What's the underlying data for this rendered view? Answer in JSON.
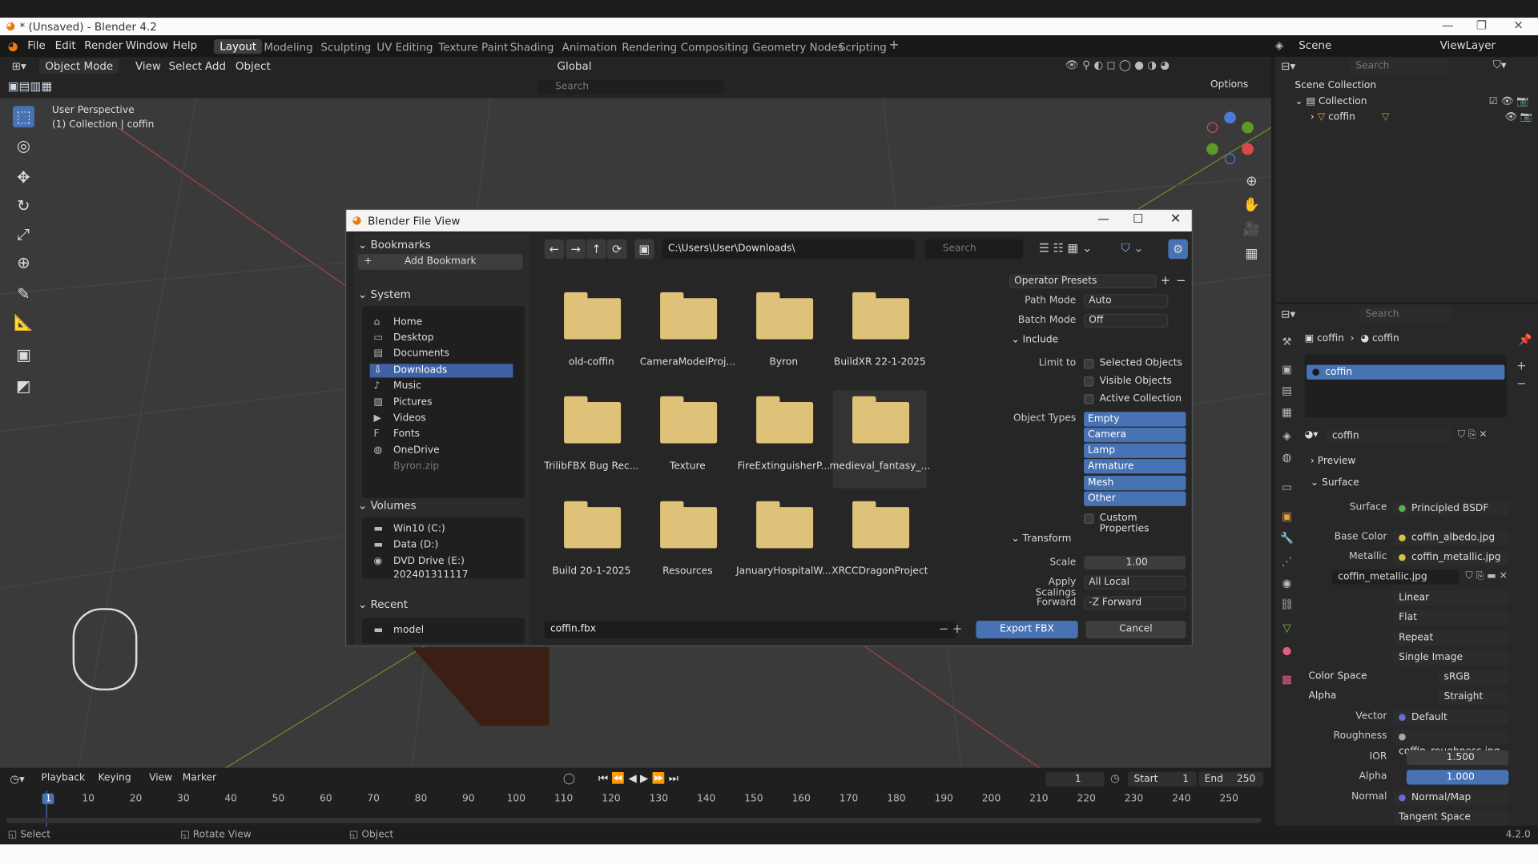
{
  "window": {
    "title": "* (Unsaved) - Blender 4.2"
  },
  "menu": [
    "File",
    "Edit",
    "Render",
    "Window",
    "Help"
  ],
  "workspaces": [
    "Layout",
    "Modeling",
    "Sculpting",
    "UV Editing",
    "Texture Paint",
    "Shading",
    "Animation",
    "Rendering",
    "Compositing",
    "Geometry Nodes",
    "Scripting"
  ],
  "scene": {
    "scene_label": "Scene",
    "viewlayer_label": "ViewLayer"
  },
  "viewport_header": {
    "mode": "Object Mode",
    "view": "View",
    "select": "Select",
    "add": "Add",
    "object": "Object",
    "orientation": "Global",
    "search_placeholder": "Search",
    "options": "Options"
  },
  "viewport": {
    "perspective": "User Perspective",
    "collection_info": "(1) Collection | coffin"
  },
  "dialog": {
    "title": "Blender File View",
    "bookmarks": {
      "header": "Bookmarks",
      "add_label": "Add Bookmark"
    },
    "system": {
      "header": "System",
      "items": [
        "Home",
        "Desktop",
        "Documents",
        "Downloads",
        "Music",
        "Pictures",
        "Videos",
        "Fonts",
        "OneDrive",
        "Byron.zip"
      ]
    },
    "volumes": {
      "header": "Volumes",
      "items": [
        "Win10 (C:)",
        "Data (D:)",
        "DVD Drive (E:) 202401311117"
      ]
    },
    "recent": {
      "header": "Recent",
      "items": [
        "model"
      ]
    },
    "path": "C:\\Users\\User\\Downloads\\",
    "search_placeholder": "Search",
    "folders": [
      "old-coffin",
      "CameraModelProj...",
      "Byron",
      "BuildXR 22-1-2025",
      "TrilibFBX Bug Rec...",
      "Texture",
      "FireExtinguisherP...",
      "medieval_fantasy_...",
      "Build 20-1-2025",
      "Resources",
      "JanuaryHospitalW...",
      "XRCCDragonProject"
    ],
    "filename": "coffin.fbx",
    "export_label": "Export FBX",
    "cancel_label": "Cancel",
    "operator": {
      "presets": "Operator Presets",
      "path_mode_label": "Path Mode",
      "path_mode": "Auto",
      "batch_mode_label": "Batch Mode",
      "batch_mode": "Off",
      "include_header": "Include",
      "limit_to_label": "Limit to",
      "limit_options": [
        "Selected Objects",
        "Visible Objects",
        "Active Collection"
      ],
      "object_types_label": "Object Types",
      "object_types": [
        "Empty",
        "Camera",
        "Lamp",
        "Armature",
        "Mesh",
        "Other"
      ],
      "custom_props": "Custom Properties",
      "transform_header": "Transform",
      "scale_label": "Scale",
      "scale": "1.00",
      "apply_scalings_label": "Apply Scalings",
      "apply_scalings": "All Local",
      "forward_label": "Forward",
      "forward": "-Z Forward"
    }
  },
  "outliner": {
    "search_placeholder": "Search",
    "scene_collection": "Scene Collection",
    "collection": "Collection",
    "object": "coffin"
  },
  "properties": {
    "search_placeholder": "Search",
    "breadcrumb_object": "coffin",
    "breadcrumb_material": "coffin",
    "material_slot": "coffin",
    "material_name": "coffin",
    "preview": "Preview",
    "surface_header": "Surface",
    "surface_label": "Surface",
    "surface": "Principled BSDF",
    "base_color_label": "Base Color",
    "base_color": "coffin_albedo.jpg",
    "metallic_label": "Metallic",
    "metallic": "coffin_metallic.jpg",
    "image_name": "coffin_metallic.jpg",
    "interp": "Linear",
    "proj": "Flat",
    "ext": "Repeat",
    "source": "Single Image",
    "color_space_label": "Color Space",
    "color_space": "sRGB",
    "alpha_mode_label": "Alpha",
    "alpha_mode": "Straight",
    "vector_label": "Vector",
    "vector": "Default",
    "roughness_label": "Roughness",
    "roughness": "coffin_roughness.jpg",
    "ior_label": "IOR",
    "ior": "1.500",
    "alpha_label": "Alpha",
    "alpha": "1.000",
    "normal_label": "Normal",
    "normal": "Normal/Map",
    "tangent": "Tangent Space"
  },
  "timeline": {
    "playback": "Playback",
    "keying": "Keying",
    "view": "View",
    "marker": "Marker",
    "current": "1",
    "start_label": "Start",
    "start": "1",
    "end_label": "End",
    "end": "250",
    "ticks": [
      "1",
      "10",
      "20",
      "30",
      "40",
      "50",
      "60",
      "70",
      "80",
      "90",
      "100",
      "110",
      "120",
      "130",
      "140",
      "150",
      "160",
      "170",
      "180",
      "190",
      "200",
      "210",
      "220",
      "230",
      "240",
      "250"
    ]
  },
  "status": {
    "select": "Select",
    "rotate": "Rotate View",
    "object": "Object",
    "version": "4.2.0"
  },
  "colors": {
    "accent": "#4772b3",
    "folder": "#dfc27a",
    "selected": "#3f62a6"
  }
}
